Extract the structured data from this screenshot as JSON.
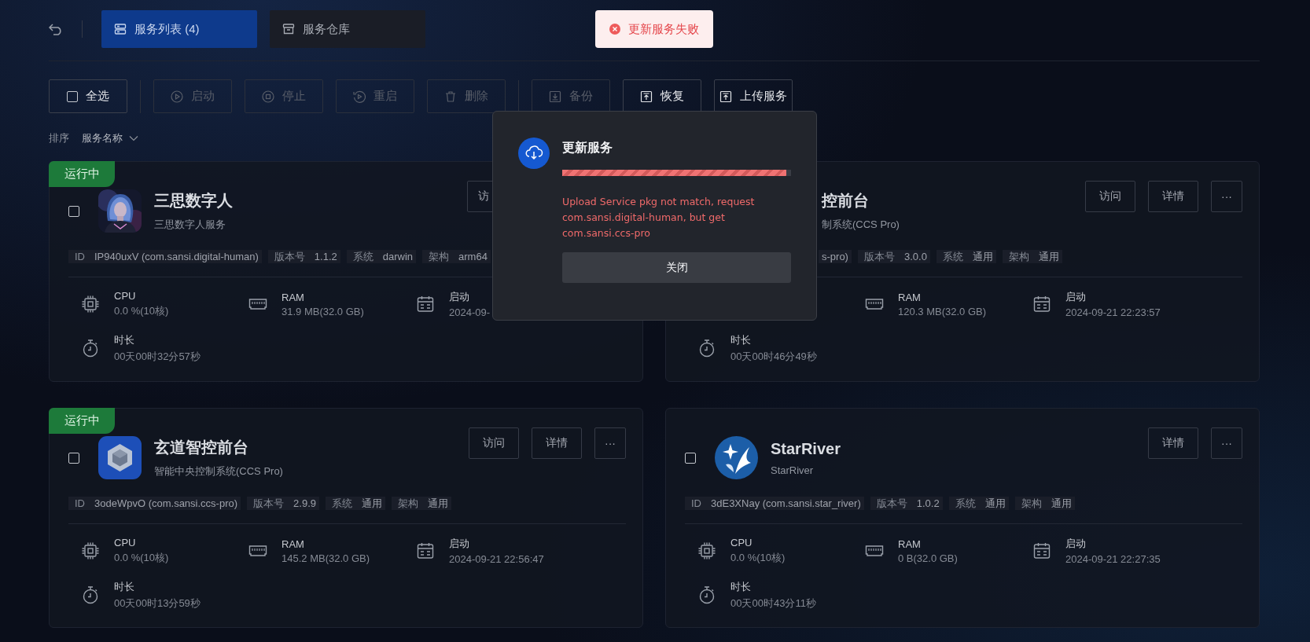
{
  "header": {
    "tabs": [
      {
        "kind": "list",
        "label": "服务列表 (4)",
        "selected": true
      },
      {
        "kind": "store",
        "label": "服务仓库",
        "selected": false
      }
    ]
  },
  "toast": {
    "kind": "error",
    "text": "更新服务失败"
  },
  "toolbar": [
    [
      {
        "kind": "select_all",
        "label": "全选",
        "disabled": false,
        "checked": false
      }
    ],
    [
      {
        "kind": "start",
        "label": "启动",
        "disabled": true
      },
      {
        "kind": "stop",
        "label": "停止",
        "disabled": true
      },
      {
        "kind": "restart",
        "label": "重启",
        "disabled": true
      },
      {
        "kind": "delete",
        "label": "删除",
        "disabled": true
      }
    ],
    [
      {
        "kind": "backup",
        "label": "备份",
        "disabled": true
      },
      {
        "kind": "restore",
        "label": "恢复",
        "disabled": false
      },
      {
        "kind": "upload",
        "label": "上传服务",
        "disabled": false
      }
    ]
  ],
  "sort": {
    "label": "排序",
    "value": "服务名称"
  },
  "cards": [
    {
      "status": "运行中",
      "checked": false,
      "avatar": {
        "kind": "picture"
      },
      "title": "三思数字人",
      "subtitle": "三思数字人服务",
      "tags": [
        {
          "label": "ID",
          "value": "IP940uxV (com.sansi.digital-human)"
        },
        {
          "label": "版本号",
          "value": "1.1.2"
        },
        {
          "label": "系统",
          "value": "darwin"
        },
        {
          "label": "架构",
          "value": "arm64"
        }
      ],
      "actions": [
        "访"
      ],
      "stats": [
        {
          "kind": "cpu",
          "label": "CPU",
          "value": "0.0 %(10核)"
        },
        {
          "kind": "ram",
          "label": "RAM",
          "value": "31.9 MB(32.0 GB)"
        },
        {
          "kind": "start",
          "label": "启动",
          "value": "2024-09-"
        },
        {
          "kind": "duration",
          "label": "时长",
          "value": "00天00时32分57秒"
        }
      ]
    },
    {
      "title": "控前台",
      "subtitle": "制系统(CCS Pro)",
      "tags": [
        {
          "value": "s-pro)"
        },
        {
          "label": "版本号",
          "value": "3.0.0"
        },
        {
          "label": "系统",
          "value": "通用"
        },
        {
          "label": "架构",
          "value": "通用"
        }
      ],
      "actions": [
        "访问",
        "详情",
        "···"
      ],
      "stats": [
        {
          "kind": "ram",
          "label": "RAM",
          "value": "120.3 MB(32.0 GB)"
        },
        {
          "kind": "start",
          "label": "启动",
          "value": "2024-09-21 22:23:57"
        },
        {
          "kind": "duration",
          "label": "时长",
          "value": "00天00时46分49秒"
        }
      ]
    },
    {
      "status": "运行中",
      "checked": false,
      "avatar": {
        "kind": "hexagon"
      },
      "title": "玄道智控前台",
      "subtitle": "智能中央控制系统(CCS Pro)",
      "tags": [
        {
          "label": "ID",
          "value": "3odeWpvO (com.sansi.ccs-pro)"
        },
        {
          "label": "版本号",
          "value": "2.9.9"
        },
        {
          "label": "系统",
          "value": "通用"
        },
        {
          "label": "架构",
          "value": "通用"
        }
      ],
      "actions": [
        "访问",
        "详情",
        "···"
      ],
      "stats": [
        {
          "kind": "cpu",
          "label": "CPU",
          "value": "0.0 %(10核)"
        },
        {
          "kind": "ram",
          "label": "RAM",
          "value": "145.2 MB(32.0 GB)"
        },
        {
          "kind": "start",
          "label": "启动",
          "value": "2024-09-21 22:56:47"
        },
        {
          "kind": "duration",
          "label": "时长",
          "value": "00天00时13分59秒"
        }
      ]
    },
    {
      "checked": false,
      "avatar": {
        "kind": "star"
      },
      "title": "StarRiver",
      "subtitle": "StarRiver",
      "tags": [
        {
          "label": "ID",
          "value": "3dE3XNay (com.sansi.star_river)"
        },
        {
          "label": "版本号",
          "value": "1.0.2"
        },
        {
          "label": "系统",
          "value": "通用"
        },
        {
          "label": "架构",
          "value": "通用"
        }
      ],
      "actions": [
        "详情",
        "···"
      ],
      "stats": [
        {
          "kind": "cpu",
          "label": "CPU",
          "value": "0.0 %(10核)"
        },
        {
          "kind": "ram",
          "label": "RAM",
          "value": "0 B(32.0 GB)"
        },
        {
          "kind": "start",
          "label": "启动",
          "value": "2024-09-21 22:27:35"
        },
        {
          "kind": "duration",
          "label": "时长",
          "value": "00天00时43分11秒"
        }
      ]
    }
  ],
  "modal": {
    "title": "更新服务",
    "level": 0.98,
    "message": "Upload Service pkg not match, request com.sansi.digital-human, but get com.sansi.ccs-pro",
    "button": "关闭"
  }
}
